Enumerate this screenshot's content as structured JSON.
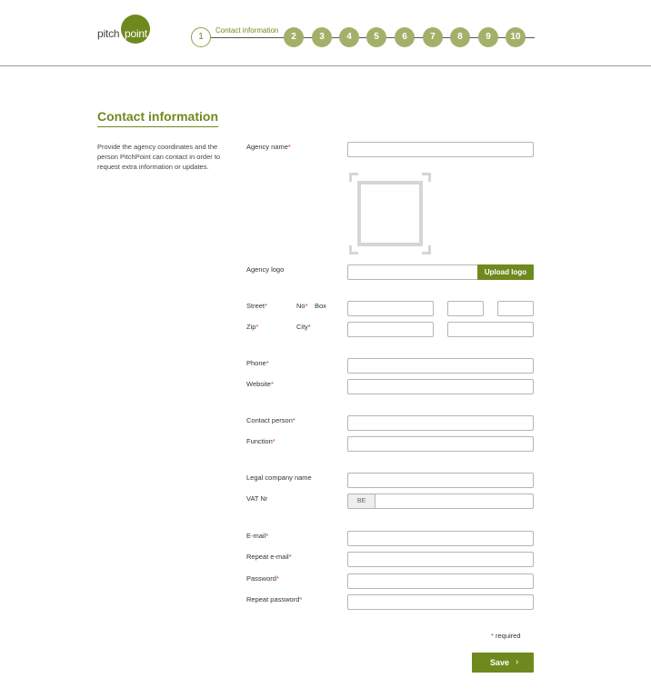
{
  "brand": {
    "logo_left": "pitch",
    "logo_right": "point",
    "accent": "#6e8a1f",
    "step_color": "#a3b06a"
  },
  "stepper": {
    "active_step": "1",
    "active_label": "Contact information",
    "steps": [
      "2",
      "3",
      "4",
      "5",
      "6",
      "7",
      "8",
      "9",
      "10"
    ]
  },
  "section": {
    "title": "Contact information",
    "description": "Provide the agency coordinates and the person PitchPoint can contact in order to request extra information or updates."
  },
  "form": {
    "agency_name": {
      "label": "Agency name",
      "req": "*",
      "value": ""
    },
    "agency_logo": {
      "label": "Agency logo",
      "value": "",
      "upload_label": "Upload logo"
    },
    "street": {
      "label": "Street",
      "req": "*",
      "value": ""
    },
    "no": {
      "label": "No",
      "req": "*",
      "value": ""
    },
    "box": {
      "label": "Box",
      "value": ""
    },
    "zip": {
      "label": "Zip",
      "req": "*",
      "value": ""
    },
    "city": {
      "label": "City",
      "req": "*",
      "value": ""
    },
    "phone": {
      "label": "Phone",
      "req": "*",
      "value": ""
    },
    "website": {
      "label": "Website",
      "req": "*",
      "value": ""
    },
    "contact_person": {
      "label": "Contact person",
      "req": "*",
      "value": ""
    },
    "function": {
      "label": "Function",
      "req": "*",
      "value": ""
    },
    "legal_company_name": {
      "label": "Legal company name",
      "value": ""
    },
    "vat_nr": {
      "label": "VAT Nr",
      "prefix": "BE",
      "value": ""
    },
    "email": {
      "label": "E-mail",
      "req": "*",
      "value": ""
    },
    "repeat_email": {
      "label": "Repeat e-mail",
      "req": "*",
      "value": ""
    },
    "password": {
      "label": "Password",
      "req": "*",
      "value": ""
    },
    "repeat_password": {
      "label": "Repeat password",
      "req": "*",
      "value": ""
    }
  },
  "footer": {
    "required_star": "*",
    "required_text": " required",
    "save_label": "Save",
    "save_icon": "chevron-right-icon"
  }
}
